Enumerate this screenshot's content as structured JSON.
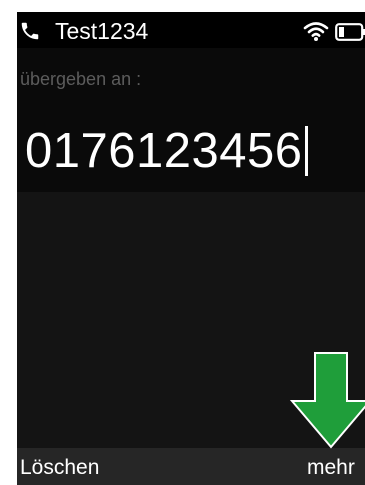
{
  "status_bar": {
    "title": "Test1234",
    "icons": [
      "phone-icon",
      "wifi-icon",
      "battery-icon"
    ]
  },
  "entry": {
    "label": "übergeben an :",
    "number": "0176123456"
  },
  "softkeys": {
    "left_label": "Löschen",
    "right_label": "mehr"
  },
  "annotation": {
    "icon": "down-arrow-icon",
    "color": "#1f9e3a"
  },
  "colors": {
    "screen_bg": "#141414",
    "status_bg": "#000000",
    "softkey_bg": "#262626",
    "label_text": "#5c5c5c",
    "text": "#ffffff"
  }
}
